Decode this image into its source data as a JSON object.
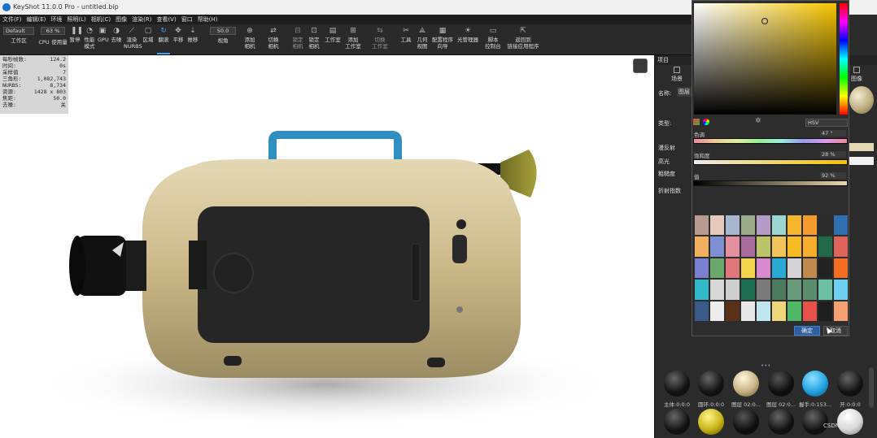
{
  "window": {
    "title": "KeyShot 11.0.0 Pro - untitled.bip"
  },
  "menu": [
    "文件(F)",
    "编辑(E)",
    "环境",
    "照明(L)",
    "相机(C)",
    "图像",
    "渲染(R)",
    "查看(V)",
    "窗口",
    "帮助(H)"
  ],
  "toolbar": {
    "workspace_select": "Default",
    "workspace_label": "工作区",
    "zoom_value": "63 %",
    "cpu_label": "CPU",
    "usage_label": "使用量",
    "pause_label": "暂停",
    "perf_label": "性能\n模式",
    "gpu_label": "GPU",
    "denoise_label": "去噪",
    "nurbs_label": "渲染\nNURBS",
    "region_label": "区域",
    "tumble_label": "翻滚",
    "pan_label": "平移",
    "dolly_label": "推移",
    "fov_value": "50.0",
    "fov_label": "视角",
    "add_camera": "添加\n相机",
    "switch_camera": "切换\n相机",
    "lock_camera": "锁定\n相机",
    "lock_cam2": "锁定\n相机",
    "studio_label": "工作室",
    "add_studio": "添加\n工作室",
    "switch_studio": "切换\n工作室",
    "tools_label": "工具",
    "geometry_view": "几何\n视图",
    "config_wizard": "配置程序\n向导",
    "light_manager": "光管理器",
    "script_console": "脚本\n控制台",
    "return_app": "返回到\n链接应用程序"
  },
  "stats": [
    {
      "k": "每秒帧数:",
      "v": "124.2"
    },
    {
      "k": "时间:",
      "v": "0s"
    },
    {
      "k": "采样值",
      "v": "7"
    },
    {
      "k": "三角形:",
      "v": "1,082,743"
    },
    {
      "k": "NURBS:",
      "v": "8,734"
    },
    {
      "k": "资源:",
      "v": "1428 x 803"
    },
    {
      "k": "焦距:",
      "v": "50.0"
    },
    {
      "k": "去噪:",
      "v": "关"
    }
  ],
  "panel": {
    "header": "项目",
    "tab_scene": "场景",
    "tab_image": "图像",
    "name_label": "名称:",
    "name_value": "图层",
    "type_label": "类型:",
    "diffuse_label": "漫反射",
    "specular_label": "高光",
    "roughness_label": "粗糙度",
    "ior_label": "折射指数"
  },
  "colorpicker": {
    "mode": "HSV",
    "hue_label": "色调",
    "hue_value": "47 °",
    "sat_label": "饱和度",
    "sat_value": "28 %",
    "val_label": "值",
    "val_value": "92 %",
    "ok_label": "确定",
    "cancel_label": "取消",
    "swatches": [
      "#b89a90",
      "#e6c9b9",
      "#a7b7cf",
      "#9aab8a",
      "#b49ac6",
      "#9bd6d2",
      "#f5b62d",
      "#f39b2c",
      "#2b2b2b",
      "#2f6fb0",
      "#f0b060",
      "#7d8fd2",
      "#e48f9d",
      "#a86c9c",
      "#bcc46a",
      "#f2c55c",
      "#f7bb23",
      "#f6ae2c",
      "#20694a",
      "#e0645c",
      "#7b7fcf",
      "#6aa86b",
      "#e0757a",
      "#f2d34c",
      "#d88ad1",
      "#29a8d4",
      "#d4d4d4",
      "#c08a4f",
      "#222222",
      "#f36d22",
      "#2fb8c8",
      "#d7d7d7",
      "#cfcfcf",
      "#1e6e51",
      "#7a7a7a",
      "#4c7a5f",
      "#6a9a7c",
      "#5a8e6c",
      "#6ac0a0",
      "#6dd0f2",
      "#3a5a8a",
      "#ededed",
      "#5a3018",
      "#e8e8e8",
      "#bfe6ee",
      "#f0d67a",
      "#50b864",
      "#e8504c",
      "#1e1e1e",
      "#f5a070"
    ]
  },
  "materials": {
    "labels": [
      "主体:0:0:0",
      "圆环:0:0:0",
      "图层 02:0...",
      "图层 02:0...",
      "握手:0:153...",
      "开:0:0:0"
    ]
  },
  "watermark": "CSDN @AE7"
}
